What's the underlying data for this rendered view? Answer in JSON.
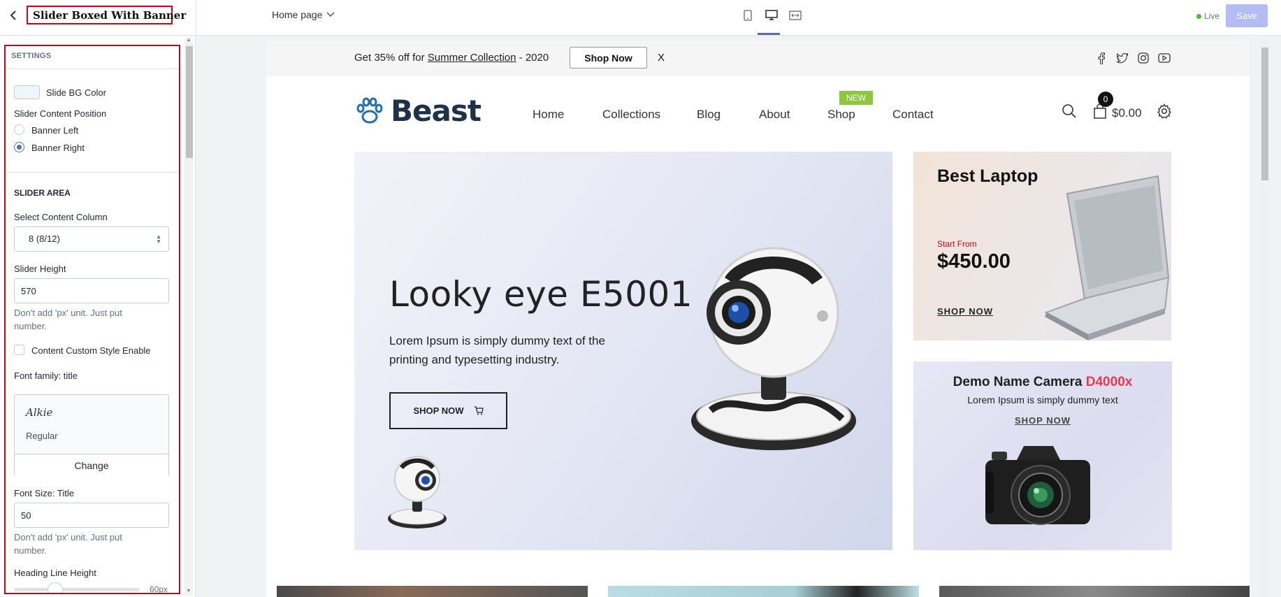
{
  "editor": {
    "panel_title": "Slider Boxed With Banner",
    "page_select_label": "Home page",
    "live_label": "Live",
    "save_label": "Save"
  },
  "settings": {
    "heading": "SETTINGS",
    "slide_bg_color_label": "Slide BG Color",
    "slide_bg_color": "#eef6fa",
    "content_position_label": "Slider Content Position",
    "content_position_options": [
      "Banner Left",
      "Banner Right"
    ],
    "content_position_selected": "Banner Right",
    "slider_area_heading": "SLIDER AREA",
    "content_column_label": "Select Content Column",
    "content_column_value": "8 (8/12)",
    "slider_height_label": "Slider Height",
    "slider_height_value": "570",
    "slider_height_help": "Don't add 'px' unit. Just put number.",
    "custom_style_label": "Content Custom Style Enable",
    "custom_style_checked": false,
    "font_family_label": "Font family: title",
    "font_family_name": "Alkie",
    "font_family_style": "Regular",
    "change_label": "Change",
    "font_size_label": "Font Size: Title",
    "font_size_value": "50",
    "font_size_help": "Don't add 'px' unit. Just put number.",
    "line_height_label": "Heading Line Height",
    "line_height_value": "60px"
  },
  "store": {
    "announcement": {
      "prefix": "Get 35% off for ",
      "link": "Summer Collection",
      "suffix": " - 2020",
      "button": "Shop Now",
      "close": "X"
    },
    "social_icons": [
      "facebook-icon",
      "twitter-icon",
      "instagram-icon",
      "youtube-icon"
    ],
    "logo_text": "Beast",
    "nav": [
      "Home",
      "Collections",
      "Blog",
      "About",
      "Shop",
      "Contact"
    ],
    "new_badge": "NEW",
    "cart_count": "0",
    "cart_total": "$0.00",
    "hero": {
      "title": "Looky eye E5001",
      "subtitle": "Lorem Ipsum is simply dummy text of the printing and typesetting industry.",
      "button": "SHOP NOW"
    },
    "banner_laptop": {
      "title": "Best Laptop",
      "from_label": "Start From",
      "price": "$450.00",
      "link": "SHOP NOW"
    },
    "banner_camera": {
      "title": "Demo Name Camera ",
      "title_highlight": "D4000x",
      "subtitle": "Lorem Ipsum is simply dummy text",
      "link": "SHOP NOW"
    }
  },
  "colors": {
    "accent": "#5c6ac4",
    "highlight_box": "#d0021b",
    "new_badge": "#8dc63f",
    "price_red": "#e8394c"
  }
}
